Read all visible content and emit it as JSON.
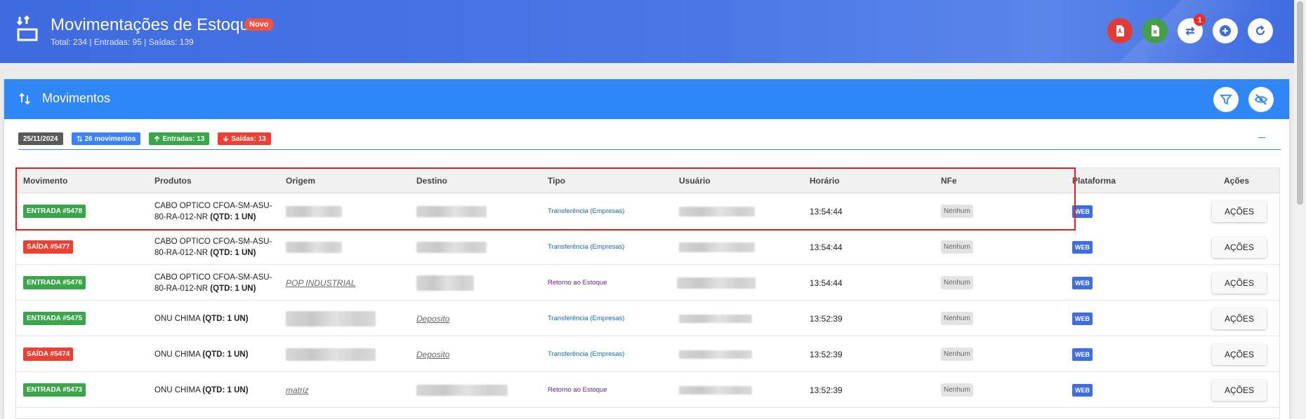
{
  "header": {
    "title": "Movimentações de Estoque",
    "new_badge": "Novo",
    "subtitle": "Total: 234 | Entradas: 95 | Saídas: 139",
    "transfer_badge_count": "1",
    "buttons": [
      {
        "name": "pdf-export-button",
        "icon": "pdf-icon",
        "color": "#e53935"
      },
      {
        "name": "excel-export-button",
        "icon": "excel-icon",
        "color": "#43a047"
      },
      {
        "name": "transfer-button",
        "icon": "swap-icon",
        "color": "#ffffff"
      },
      {
        "name": "add-button",
        "icon": "plus-circle-icon",
        "color": "#ffffff"
      },
      {
        "name": "refresh-button",
        "icon": "refresh-icon",
        "color": "#ffffff"
      }
    ]
  },
  "card": {
    "title": "Movimentos",
    "chips": {
      "date": "25/11/2024",
      "total": "26 movimentos",
      "entradas": "Entradas: 13",
      "saidas": "Saídas: 13"
    }
  },
  "table": {
    "columns": [
      "Movimento",
      "Produtos",
      "Origem",
      "Destino",
      "Tipo",
      "Usuário",
      "Horário",
      "NFe",
      "Plataforma",
      "Ações"
    ],
    "rows": [
      {
        "movimento": "ENTRADA #5478",
        "kind": "in",
        "produto": "CABO OPTICO CFOA-SM-ASU-80-RA-012-NR",
        "qtd": "(QTD: 1 UN)",
        "origem": "",
        "destino": "",
        "tipo": "Transferência (Empresas)",
        "tipo_kind": "t",
        "usuario": "",
        "horario": "13:54:44",
        "nfe": "Nenhum",
        "plataforma": "WEB",
        "acoes": "AÇÕES"
      },
      {
        "movimento": "SAÍDA #5477",
        "kind": "out",
        "produto": "CABO OPTICO CFOA-SM-ASU-80-RA-012-NR",
        "qtd": "(QTD: 1 UN)",
        "origem": "",
        "destino": "",
        "tipo": "Transferência (Empresas)",
        "tipo_kind": "t",
        "usuario": "",
        "horario": "13:54:44",
        "nfe": "Nenhum",
        "plataforma": "WEB",
        "acoes": "AÇÕES"
      },
      {
        "movimento": "ENTRADA #5476",
        "kind": "in",
        "produto": "CABO OPTICO CFOA-SM-ASU-80-RA-012-NR",
        "qtd": "(QTD: 1 UN)",
        "origem": "POP INDUSTRIAL",
        "destino": "",
        "tipo": "Retorno ao Estoque",
        "tipo_kind": "r",
        "usuario": "",
        "horario": "13:54:44",
        "nfe": "Nenhum",
        "plataforma": "WEB",
        "acoes": "AÇÕES"
      },
      {
        "movimento": "ENTRADA #5475",
        "kind": "in",
        "produto": "ONU CHIMA",
        "qtd": "(QTD: 1 UN)",
        "origem": "",
        "destino": "Deposito",
        "tipo": "Transferência (Empresas)",
        "tipo_kind": "t",
        "usuario": "",
        "horario": "13:52:39",
        "nfe": "Nenhum",
        "plataforma": "WEB",
        "acoes": "AÇÕES"
      },
      {
        "movimento": "SAÍDA #5474",
        "kind": "out",
        "produto": "ONU CHIMA",
        "qtd": "(QTD: 1 UN)",
        "origem": "",
        "destino": "Deposito",
        "tipo": "Transferência (Empresas)",
        "tipo_kind": "t",
        "usuario": "",
        "horario": "13:52:39",
        "nfe": "Nenhum",
        "plataforma": "WEB",
        "acoes": "AÇÕES"
      },
      {
        "movimento": "ENTRADA #5473",
        "kind": "in",
        "produto": "ONU CHIMA",
        "qtd": "(QTD: 1 UN)",
        "origem": "matriz",
        "destino": "",
        "tipo": "Retorno ao Estoque",
        "tipo_kind": "r",
        "usuario": "",
        "horario": "13:52:39",
        "nfe": "Nenhum",
        "plataforma": "WEB",
        "acoes": "AÇÕES"
      }
    ]
  }
}
